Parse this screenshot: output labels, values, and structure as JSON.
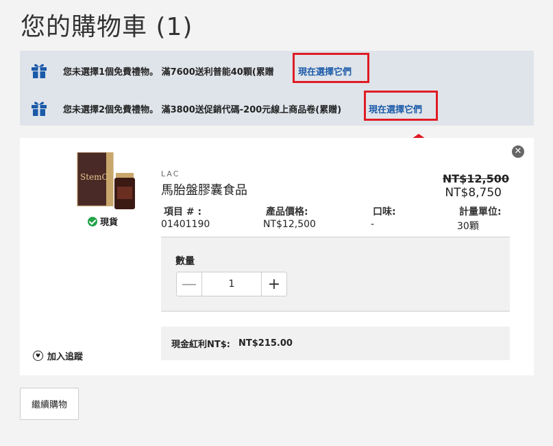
{
  "page": {
    "title": "您的購物車 (1)"
  },
  "promos": [
    {
      "text": "您未選擇1個免費禮物。 滿7600送利普能40顆(累贈",
      "link": "現在選擇它們"
    },
    {
      "text": "您未選擇2個免費禮物。 滿3800送促銷代碼-200元線上商品卷(累贈)",
      "link": "現在選擇它們"
    }
  ],
  "product": {
    "image_text": "StemC",
    "brand": "LAC",
    "name": "馬胎盤膠囊食品",
    "stock": "現貨",
    "old_price": "NT$12,500",
    "new_price": "NT$8,750",
    "attributes": [
      {
        "label": "項目 # :",
        "value": "01401190"
      },
      {
        "label": "產品價格:",
        "value": "NT$12,500"
      },
      {
        "label": "口味:",
        "value": "-"
      },
      {
        "label": "計量單位:",
        "value": "30顆"
      }
    ]
  },
  "quantity": {
    "label": "數量",
    "value": "1",
    "minus": "—",
    "plus": "+"
  },
  "cashback": {
    "label": "現金紅利NT$:",
    "value": "NT$215.00"
  },
  "wishlist": {
    "label": "加入追蹤"
  },
  "actions": {
    "continue": "繼續購物",
    "close": "✕"
  },
  "colors": {
    "accent_link": "#1a5aa8",
    "highlight": "#e01b24",
    "promo_bg": "#dfe4ea",
    "stock_green": "#23a34a"
  },
  "icons": [
    "gift-icon",
    "check-icon",
    "close-icon",
    "minus-icon",
    "plus-icon",
    "heart-icon",
    "arrow-up-icon"
  ]
}
